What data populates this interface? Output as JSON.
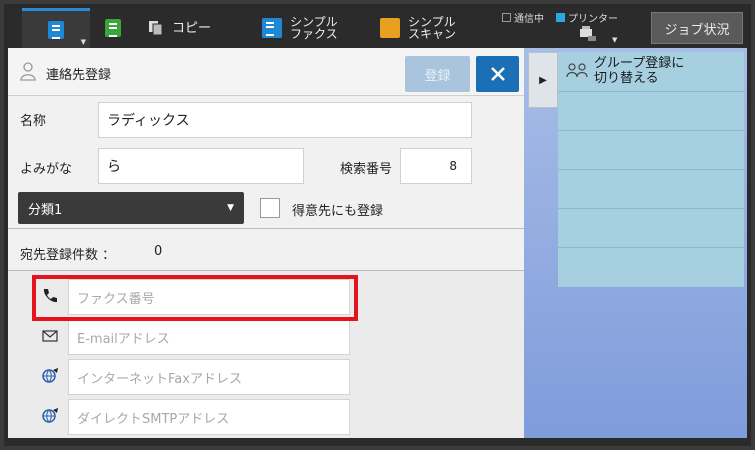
{
  "topbar": {
    "copy_label": "コピー",
    "simple_fax_label_1": "シンプル",
    "simple_fax_label_2": "ファクス",
    "simple_scan_label_1": "シンプル",
    "simple_scan_label_2": "スキャン",
    "status_comm": "通信中",
    "status_printer": "プリンター",
    "job_status_label": "ジョブ状況"
  },
  "header": {
    "title": "連絡先登録",
    "register_label": "登録"
  },
  "form": {
    "name_label": "名称",
    "name_value": "ラディックス",
    "reading_label": "よみがな",
    "reading_value": "ら",
    "search_no_label": "検索番号",
    "search_no_value": "8",
    "category_value": "分類1",
    "favorite_label": "得意先にも登録"
  },
  "count": {
    "label": "宛先登録件数 ：",
    "value": "0"
  },
  "address": {
    "fax_placeholder": "ファクス番号",
    "email_placeholder": "E-mailアドレス",
    "ifax_placeholder": "インターネットFaxアドレス",
    "smtp_placeholder": "ダイレクトSMTPアドレス"
  },
  "group_panel": {
    "switch_line1": "グループ登録に",
    "switch_line2": "切り替える"
  },
  "colors": {
    "accent": "#1a6fb5",
    "highlight": "#e3141c"
  }
}
